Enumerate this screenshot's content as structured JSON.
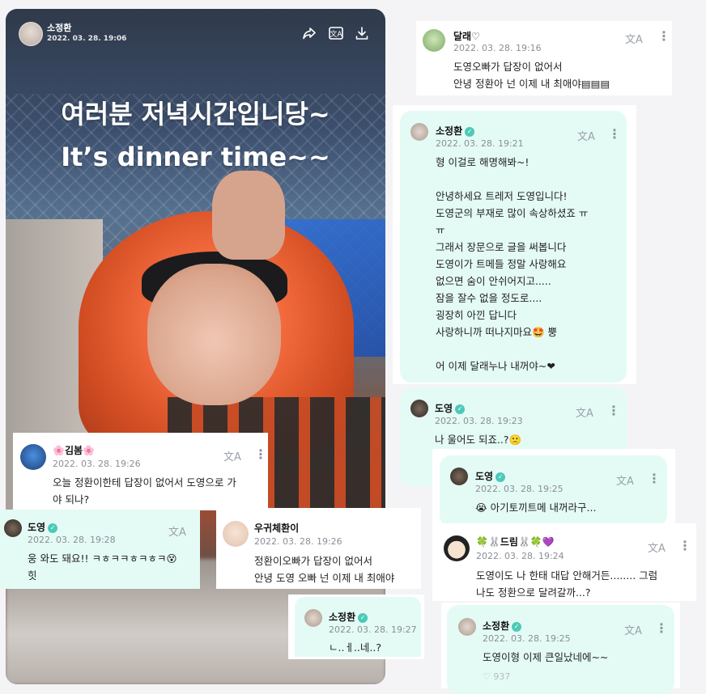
{
  "post": {
    "author": "소정환",
    "date": "2022. 03. 28. 19:06",
    "caption_line1": "여러분 저녁시간입니당~",
    "caption_line2": "It’s dinner time~~",
    "icons": [
      "share-icon",
      "translate-icon",
      "download-icon"
    ]
  },
  "comments": {
    "dallae": {
      "name": "달래♡",
      "date": "2022. 03. 28. 19:16",
      "lines": [
        "도영오빠가 답장이 없어서",
        "안녕 정환아 넌 이제 내 최애야▤▤▤"
      ]
    },
    "jh_long": {
      "name": "소정환",
      "date": "2022. 03. 28. 19:21",
      "lines": [
        "형 이걸로 해명해봐~!",
        "",
        "안녕하세요 트레저 도영입니다!",
        "도영군의 부재로 많이 속상하셨죠 ㅠ",
        "ㅠ",
        "그래서 장문으로 글을 써봅니다",
        "도영이가 트메들 정말 사랑해요",
        "없으면 숨이 안쉬어지고.....",
        "잠을 잘수 없을 정도로....",
        "굉장히 아낀 답니다",
        "사랑하니까 떠나지마요🤩 뿡",
        "",
        "어 이제 달래누나 내꺼야~❤"
      ]
    },
    "dy_1923": {
      "name": "도영",
      "date": "2022. 03. 28. 19:23",
      "text": "나 울어도 되죠..?🙁"
    },
    "jh_1925a": {
      "name": "도영",
      "date": "2022. 03. 28. 19:25",
      "text": "😭 아기토끼트메 내꺼라구..."
    },
    "dream": {
      "name": "🍀🐰드림🐰🍀💜",
      "date": "2022. 03. 28. 19:24",
      "lines": [
        "도영이도 나 한태 대답 안해거든........ 그럼",
        "나도 정환으로 달려갈까...?"
      ]
    },
    "jh_1925b": {
      "name": "소정환",
      "date": "2022. 03. 28. 19:25",
      "text": "도영이형 이제 큰일났네에~~",
      "likes": "937"
    },
    "kimbom": {
      "name": "🌸김봄🌸",
      "date": "2022. 03. 28. 19:26",
      "lines": [
        "오늘 정환이한테 답장이 없어서 도영으로 가",
        "야 되나?"
      ]
    },
    "dy_1928": {
      "name": "도영",
      "date": "2022. 03. 28. 19:28",
      "lines": [
        "웅 와도 돼요!! ㅋㅎㅋㅋㅎㅋㅎㅋ😵",
        "힛"
      ]
    },
    "uguichehwan": {
      "name": "우귀체환이",
      "date": "2022. 03. 28. 19:26",
      "lines": [
        "정환이오빠가 답장이 없어서",
        "안녕 도영 오빠 넌 이제 내 최애야"
      ]
    },
    "jh_1927": {
      "name": "소정환",
      "date": "2022. 03. 28. 19:27",
      "text": "ㄴ..ㅔ..네..?"
    }
  },
  "colors": {
    "mint": "#e4fbf5",
    "verified": "#4cc9b8",
    "muted": "#8a8f97"
  }
}
